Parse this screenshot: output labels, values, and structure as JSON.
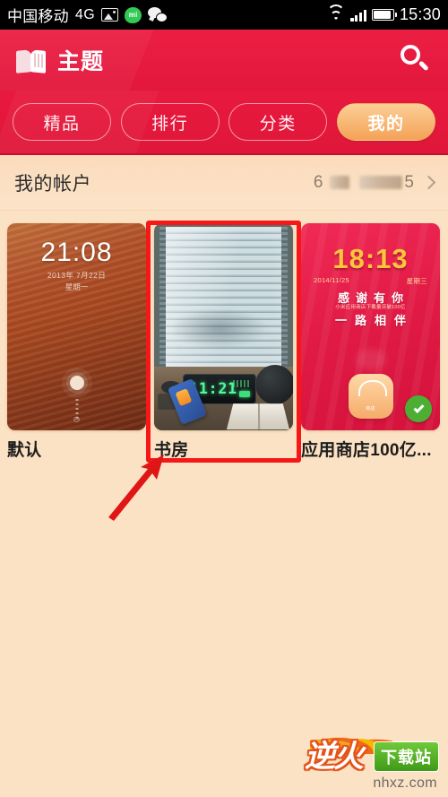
{
  "status_bar": {
    "carrier": "中国移动",
    "network": "4G",
    "icons": [
      "photo-icon",
      "mi-message-icon",
      "wechat-icon",
      "wifi-icon",
      "signal-icon",
      "battery-icon"
    ],
    "time": "15:30"
  },
  "header": {
    "title": "主题",
    "brand_icon": "theme-book-icon",
    "search_icon": "search-icon",
    "background_color": "#e8193e"
  },
  "tabs": [
    {
      "label": "精品",
      "active": false
    },
    {
      "label": "排行",
      "active": false
    },
    {
      "label": "分类",
      "active": false
    },
    {
      "label": "我的",
      "active": true
    }
  ],
  "tab_active_color": "#f4a257",
  "account_row": {
    "label": "我的帐户",
    "value_prefix": "6",
    "value_suffix": "5",
    "masked": true,
    "chevron_icon": "chevron-right-icon"
  },
  "themes": [
    {
      "name": "默认",
      "style": "wood",
      "clock": "21:08",
      "date": "2013年 7月22日",
      "weekday": "星期一",
      "applied": false,
      "selected": false
    },
    {
      "name": "书房",
      "style": "study",
      "clock": "11:21",
      "applied": false,
      "selected": true
    },
    {
      "name": "应用商店100亿...",
      "style": "promo",
      "clock": "18:13",
      "date": "2014/11/25",
      "weekday": "星期三",
      "line1": "感谢有你",
      "line2": "小米应用商店下载量突破100亿",
      "line3": "一路相伴",
      "bag_label": "商店",
      "applied": true,
      "selected": false
    }
  ],
  "annotations": {
    "highlight_color": "#f61818",
    "arrow": "annotation-arrow",
    "target": "书房"
  },
  "watermark": {
    "logo": "逆火",
    "badge": "下载站",
    "site": "nhxz.com"
  }
}
